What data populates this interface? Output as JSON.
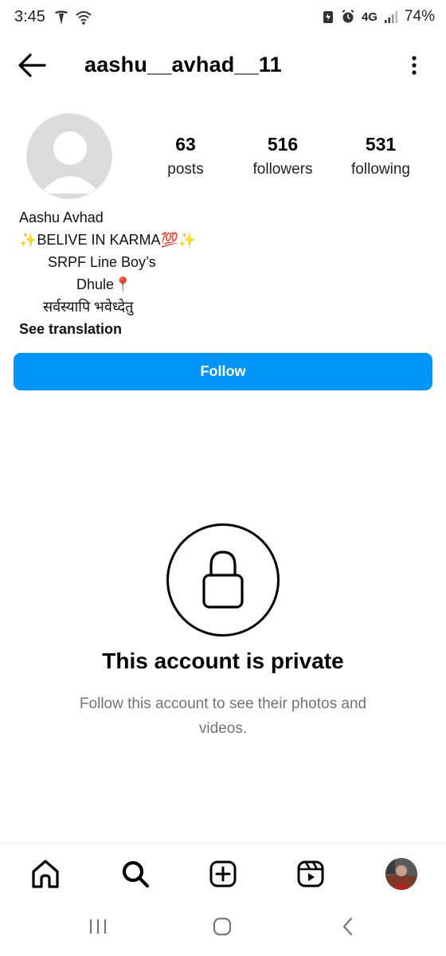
{
  "status_bar": {
    "time": "3:45",
    "network": "4G",
    "battery": "74%"
  },
  "header": {
    "username": "aashu__avhad__11"
  },
  "profile": {
    "stats": [
      {
        "value": "63",
        "label": "posts"
      },
      {
        "value": "516",
        "label": "followers"
      },
      {
        "value": "531",
        "label": "following"
      }
    ],
    "bio": {
      "name": "Aashu Avhad",
      "lines": [
        "✨BELIVE IN KARMA💯✨",
        "SRPF Line Boy’s",
        "Dhule📍",
        "सर्वस्यापि भवेध्देतु"
      ],
      "see_translation": "See translation"
    },
    "follow_label": "Follow"
  },
  "private": {
    "title": "This account is private",
    "subtitle": "Follow this account to see their photos and videos."
  },
  "colors": {
    "accent": "#0095f6",
    "muted_text": "#737373"
  },
  "icons": {
    "back": "arrow-left-icon",
    "more": "more-vertical-icon",
    "lock": "lock-icon",
    "home": "home-icon",
    "search": "search-icon",
    "create": "plus-square-icon",
    "reels": "reels-icon"
  }
}
